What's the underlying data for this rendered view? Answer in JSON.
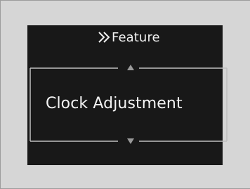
{
  "header": {
    "icon": "double-chevron-right-icon",
    "title": "Feature"
  },
  "menu": {
    "selected_item": "Clock Adjustment",
    "up_arrow_icon": "triangle-up-icon",
    "down_arrow_icon": "triangle-down-icon"
  },
  "colors": {
    "screen_background": "#181818",
    "text": "#f2f2f2",
    "frame_line": "#bfbfbf",
    "arrow": "#9a9a9a",
    "page_background": "#d6d6d6"
  }
}
